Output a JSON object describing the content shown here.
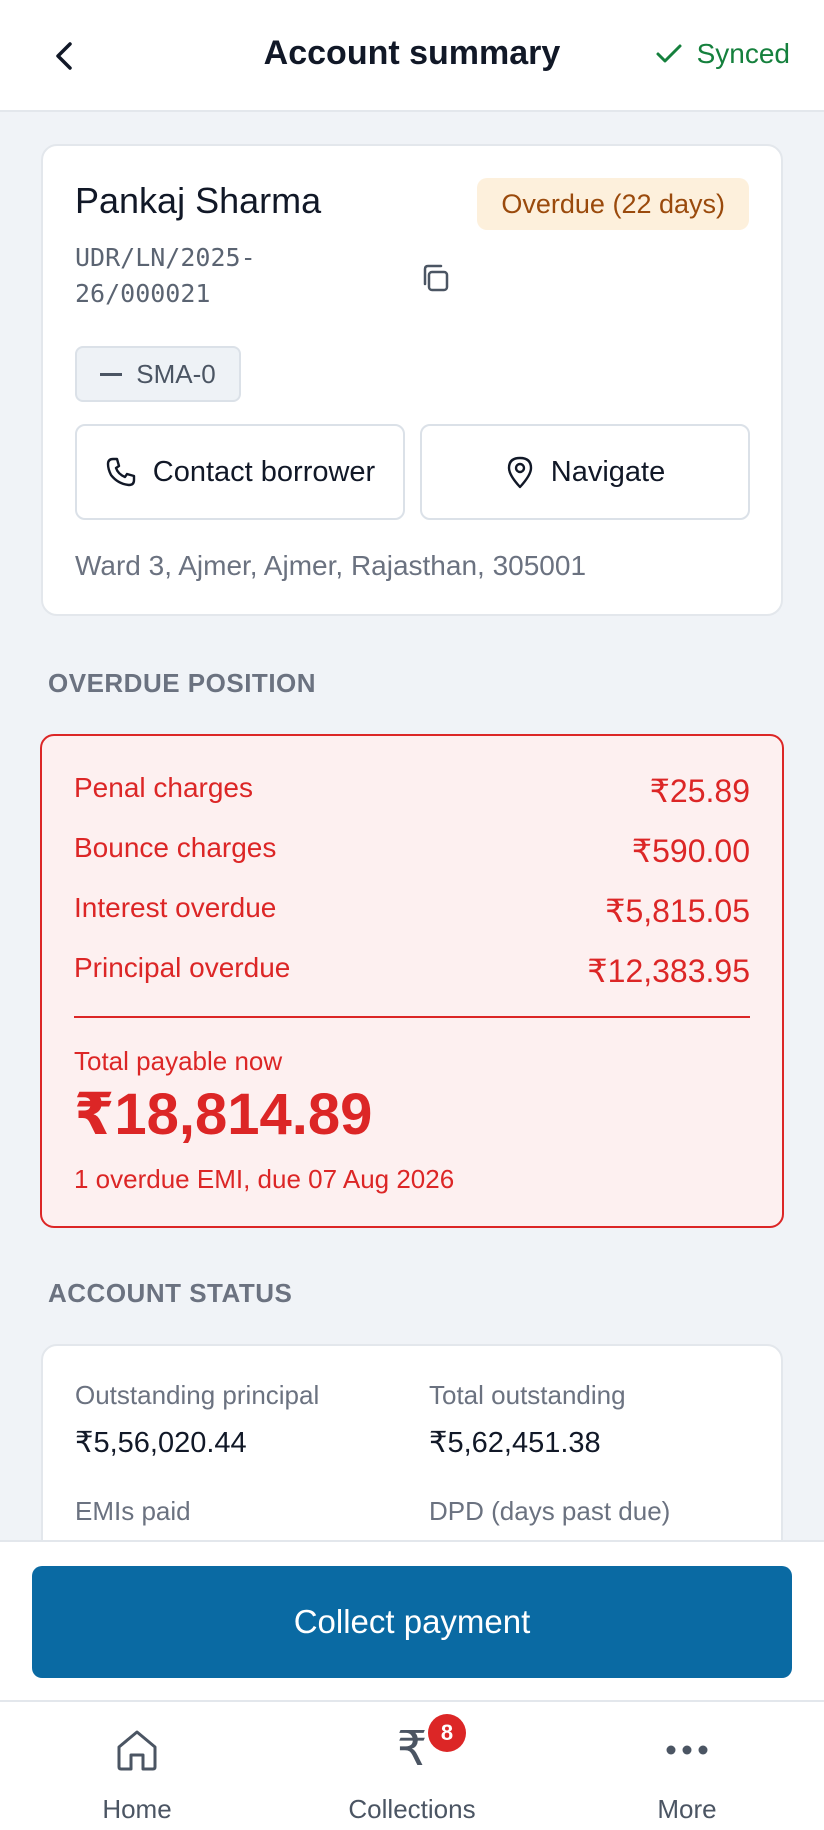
{
  "header": {
    "title": "Account summary",
    "sync_status": "Synced"
  },
  "borrower": {
    "name": "Pankaj Sharma",
    "status_badge": "Overdue (22 days)",
    "loan_id": "UDR/LN/2025-26/000021",
    "classification": "SMA-0",
    "contact_label": "Contact borrower",
    "navigate_label": "Navigate",
    "address": "Ward 3, Ajmer, Ajmer, Rajasthan, 305001"
  },
  "overdue_position": {
    "section_label": "OVERDUE POSITION",
    "rows": [
      {
        "label": "Penal charges",
        "value": "₹25.89"
      },
      {
        "label": "Bounce charges",
        "value": "₹590.00"
      },
      {
        "label": "Interest overdue",
        "value": "₹5,815.05"
      },
      {
        "label": "Principal overdue",
        "value": "₹12,383.95"
      }
    ],
    "total_label": "Total payable now",
    "total_value": "₹18,814.89",
    "note": "1 overdue EMI, due 07 Aug 2026"
  },
  "account_status": {
    "section_label": "ACCOUNT STATUS",
    "items": [
      {
        "label": "Outstanding principal",
        "value": "₹5,56,020.44"
      },
      {
        "label": "Total outstanding",
        "value": "₹5,62,451.38"
      },
      {
        "label": "EMIs paid",
        "value": ""
      },
      {
        "label": "DPD (days past due)",
        "value": ""
      }
    ]
  },
  "actions": {
    "collect_label": "Collect payment"
  },
  "nav": {
    "items": [
      {
        "label": "Home",
        "icon": "home-icon"
      },
      {
        "label": "Collections",
        "icon": "rupee-icon",
        "badge": "8"
      },
      {
        "label": "More",
        "icon": "more-icon"
      }
    ]
  },
  "colors": {
    "accent": "#0a6aa3",
    "danger": "#dc2626",
    "success": "#15803d",
    "warning_bg": "#fdf0dc"
  }
}
